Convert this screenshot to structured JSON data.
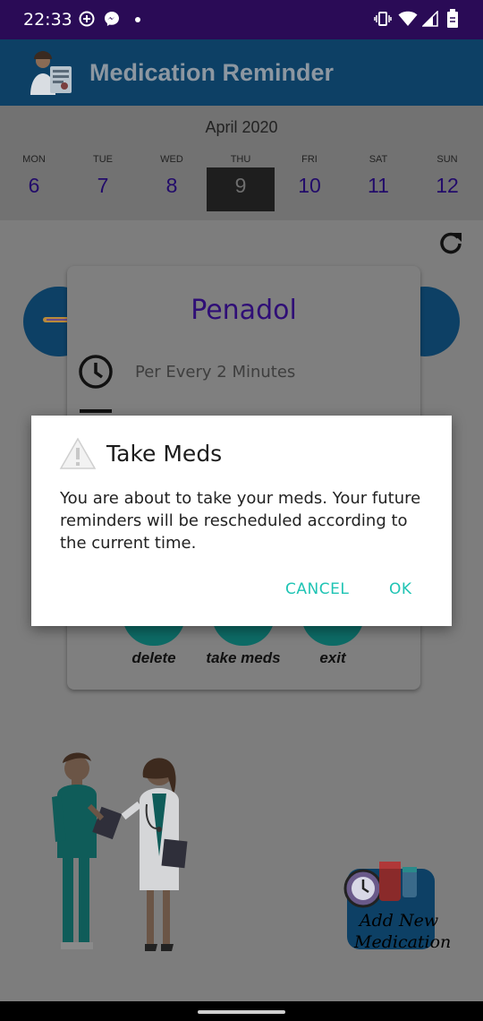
{
  "status_bar": {
    "time": "22:33",
    "left_icons": [
      "plus-circle-icon",
      "messenger-icon",
      "dot-icon"
    ],
    "right_icons": [
      "vibrate-icon",
      "wifi-icon",
      "signal-icon",
      "battery-icon"
    ]
  },
  "app_bar": {
    "title": "Medication Reminder",
    "logo": "doctor-logo-icon",
    "color": "#0d4065"
  },
  "calendar": {
    "month": "April 2020",
    "days": [
      {
        "name": "MON",
        "num": "6",
        "selected": false
      },
      {
        "name": "TUE",
        "num": "7",
        "selected": false
      },
      {
        "name": "WED",
        "num": "8",
        "selected": false
      },
      {
        "name": "THU",
        "num": "9",
        "selected": true
      },
      {
        "name": "FRI",
        "num": "10",
        "selected": false
      },
      {
        "name": "SAT",
        "num": "11",
        "selected": false
      },
      {
        "name": "SUN",
        "num": "12",
        "selected": false
      }
    ]
  },
  "refresh_icon": "refresh-icon",
  "medication_card": {
    "name": "Penadol",
    "frequency": "Per Every 2 Minutes",
    "frequency_icon": "clock-icon",
    "actions": [
      {
        "label": "delete"
      },
      {
        "label": "take meds"
      },
      {
        "label": "exit"
      }
    ]
  },
  "dialog": {
    "title": "Take Meds",
    "icon": "warning-icon",
    "message": "You are about to take your meds. Your future reminders will be rescheduled according to the current time.",
    "cancel_label": "CANCEL",
    "ok_label": "OK",
    "button_color": "#1fc4b4"
  },
  "add_medication": {
    "label_line1": "Add New",
    "label_line2": "Medication"
  }
}
